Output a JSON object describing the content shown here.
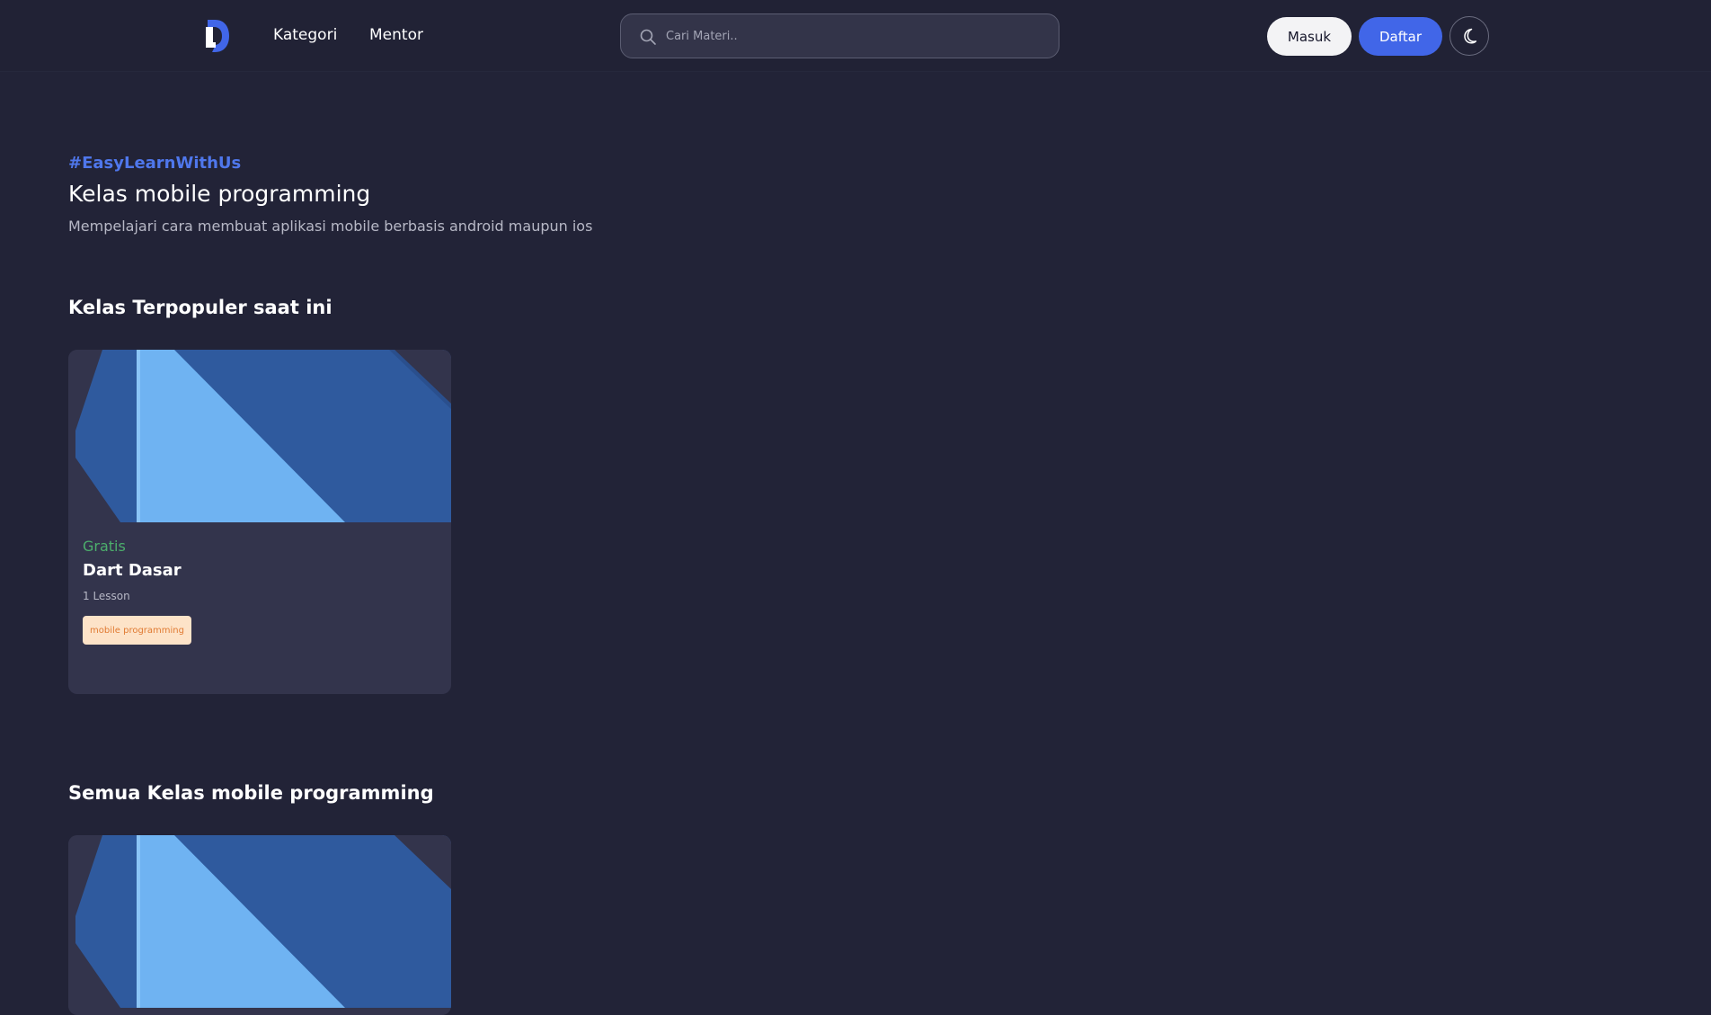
{
  "nav": {
    "logo_icon": "d-logo-icon",
    "links": [
      {
        "label": "Kategori"
      },
      {
        "label": "Mentor"
      }
    ],
    "search": {
      "placeholder": "Cari Materi..",
      "value": "",
      "icon": "search-icon"
    },
    "login_label": "Masuk",
    "register_label": "Daftar",
    "theme_icon": "moon-icon"
  },
  "hero": {
    "tag": "#EasyLearnWithUs",
    "title": "Kelas mobile programming",
    "description": "Mempelajari cara membuat aplikasi mobile berbasis android maupun ios"
  },
  "popular": {
    "title": "Kelas Terpopuler saat ini",
    "courses": [
      {
        "price": "Gratis",
        "title": "Dart Dasar",
        "lessons": "1 Lesson",
        "tag": "mobile programming"
      }
    ]
  },
  "all": {
    "title": "Semua Kelas mobile programming"
  },
  "colors": {
    "background": "#222337",
    "accent": "#4166e8",
    "card": "#33344c",
    "price_free": "#4cae6c",
    "badge_bg": "#fde3c8",
    "badge_text": "#e07b33"
  }
}
